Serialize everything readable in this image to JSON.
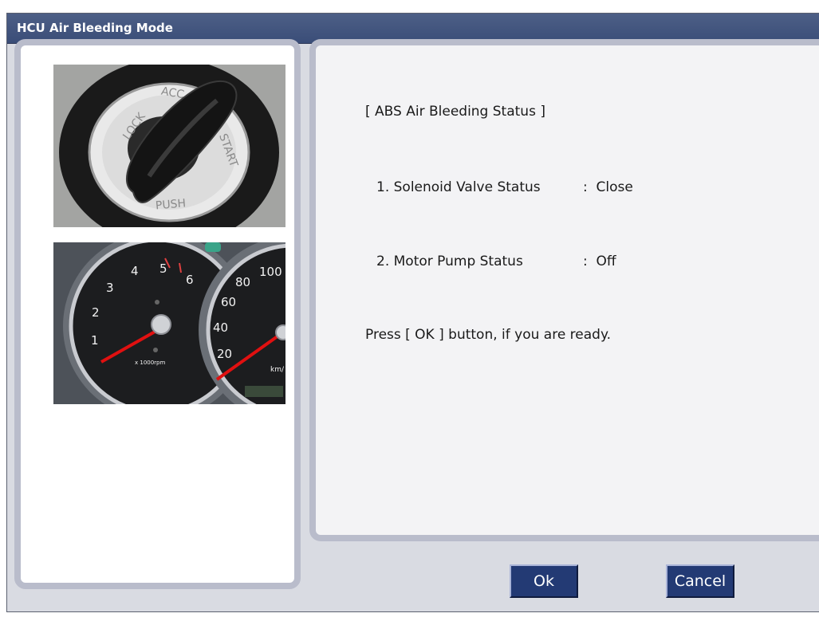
{
  "window": {
    "title": "HCU Air Bleeding Mode"
  },
  "status": {
    "heading": "[ ABS Air Bleeding Status ]",
    "items": [
      {
        "label": "1. Solenoid Valve Status",
        "value": ":  Close"
      },
      {
        "label": "2. Motor Pump Status",
        "value": ":  Off"
      }
    ],
    "instruction": "Press [ OK ] button, if you are ready."
  },
  "buttons": {
    "ok": "Ok",
    "cancel": "Cancel"
  },
  "images": {
    "ignition": {
      "icon": "ignition-key-icon",
      "labels": [
        "LOCK",
        "ACC",
        "START",
        "PUSH"
      ]
    },
    "cluster": {
      "icon": "instrument-cluster-icon",
      "tach_ticks": [
        "1",
        "2",
        "3",
        "4",
        "5",
        "6"
      ],
      "tach_unit": "x 1000rpm",
      "speed_ticks": [
        "20",
        "40",
        "60",
        "80",
        "100"
      ],
      "speed_unit": "km/"
    }
  },
  "colors": {
    "title_bar": "#3f5280",
    "button": "#233a74",
    "needle": "#e01010"
  }
}
